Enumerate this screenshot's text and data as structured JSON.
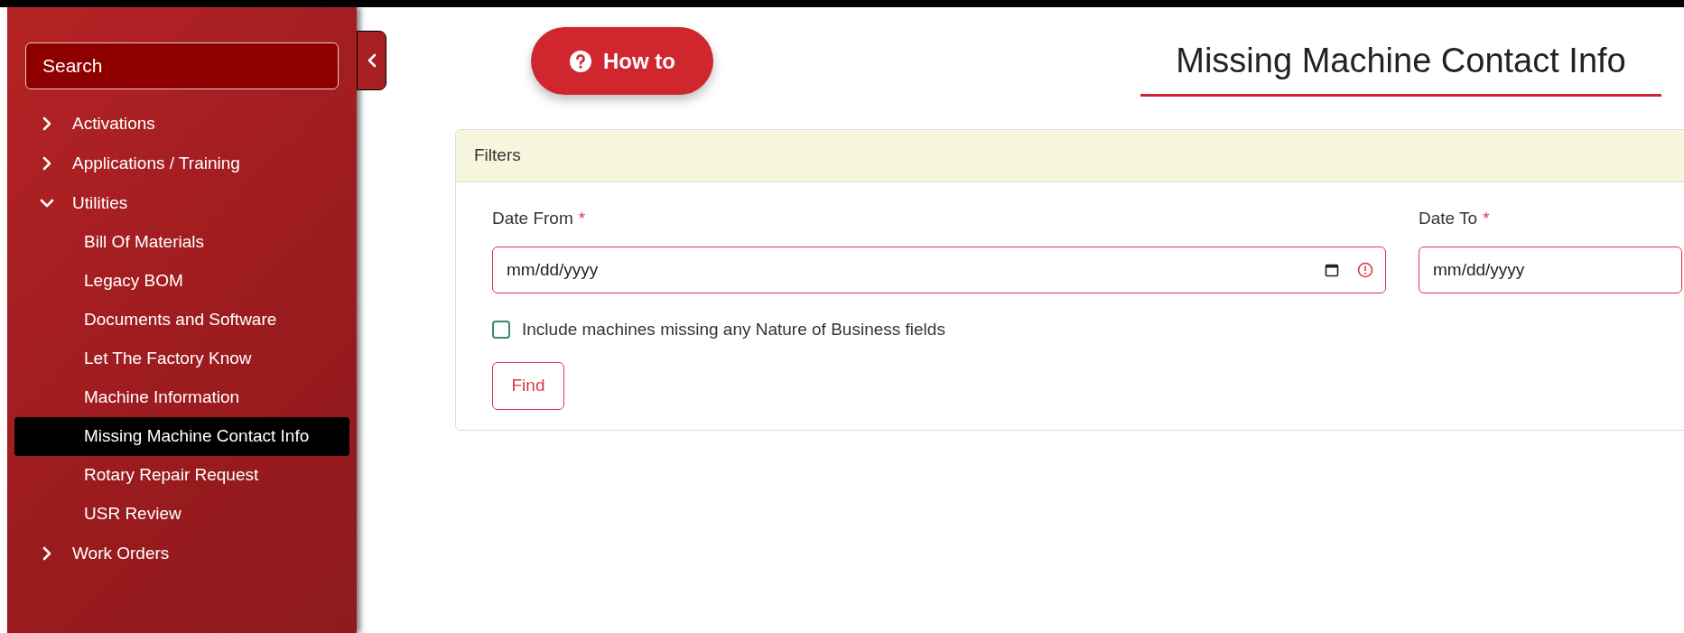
{
  "sidebar": {
    "search": {
      "placeholder": "Search"
    },
    "items": [
      {
        "label": "Activations",
        "expanded": false,
        "selected": false
      },
      {
        "label": "Applications / Training",
        "expanded": false,
        "selected": false
      },
      {
        "label": "Utilities",
        "expanded": true,
        "selected": false,
        "children": [
          {
            "label": "Bill Of Materials",
            "selected": false
          },
          {
            "label": "Legacy BOM",
            "selected": false
          },
          {
            "label": "Documents and Software",
            "selected": false
          },
          {
            "label": "Let The Factory Know",
            "selected": false
          },
          {
            "label": "Machine Information",
            "selected": false
          },
          {
            "label": "Missing Machine Contact Info",
            "selected": true
          },
          {
            "label": "Rotary Repair Request",
            "selected": false
          },
          {
            "label": "USR Review",
            "selected": false
          }
        ]
      },
      {
        "label": "Work Orders",
        "expanded": false,
        "selected": false
      }
    ]
  },
  "how_to_button": "How to",
  "page_title": "Missing Machine Contact Info",
  "filters": {
    "title": "Filters",
    "fields": [
      {
        "label": "Date From",
        "required_mark": "*",
        "placeholder": "mm/dd/yyyy",
        "invalid": true
      },
      {
        "label": "Date To",
        "required_mark": "*",
        "placeholder": "mm/dd/yyyy",
        "invalid": true
      }
    ],
    "checkbox": {
      "label": "Include machines missing any Nature of Business fields",
      "checked": false
    },
    "find_button": "Find"
  }
}
